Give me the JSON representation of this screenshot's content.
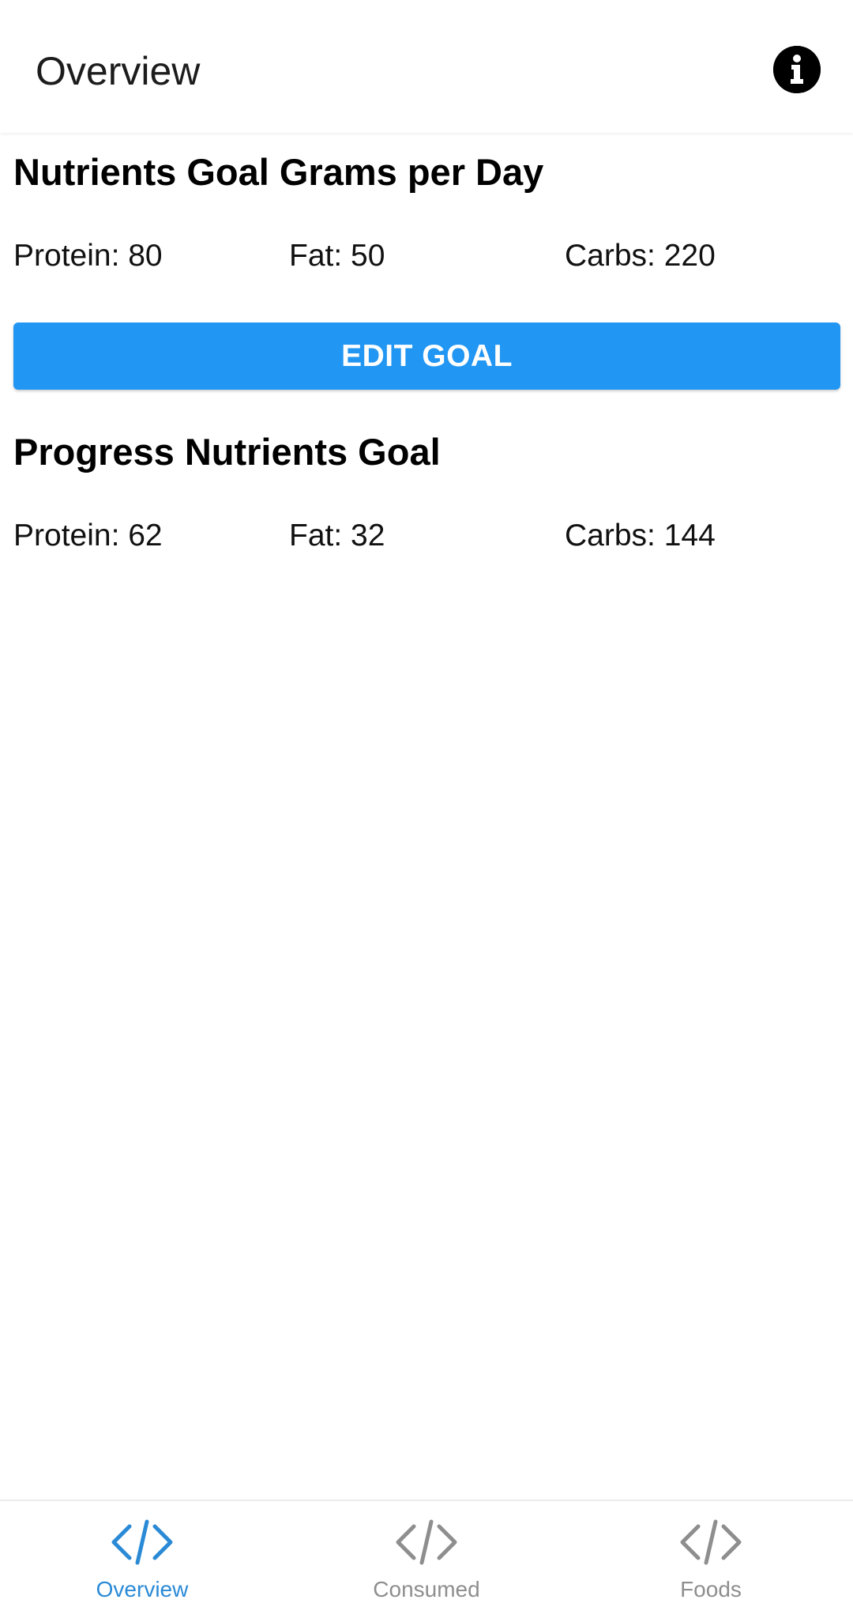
{
  "header": {
    "title": "Overview",
    "info_icon": "info-icon"
  },
  "goal_section": {
    "title": "Nutrients Goal Grams per Day",
    "protein": "Protein: 80",
    "fat": "Fat: 50",
    "carbs": "Carbs: 220"
  },
  "edit_button": {
    "label": "EDIT GOAL",
    "color": "#2196f3"
  },
  "progress_section": {
    "title": "Progress Nutrients Goal",
    "protein": "Protein: 62",
    "fat": "Fat: 32",
    "carbs": "Carbs: 144"
  },
  "tabbar": {
    "active_color": "#2a8ad6",
    "inactive_color": "#8e8e8e",
    "tabs": [
      {
        "label": "Overview",
        "icon": "code-icon",
        "active": true
      },
      {
        "label": "Consumed",
        "icon": "code-icon",
        "active": false
      },
      {
        "label": "Foods",
        "icon": "code-icon",
        "active": false
      }
    ]
  }
}
